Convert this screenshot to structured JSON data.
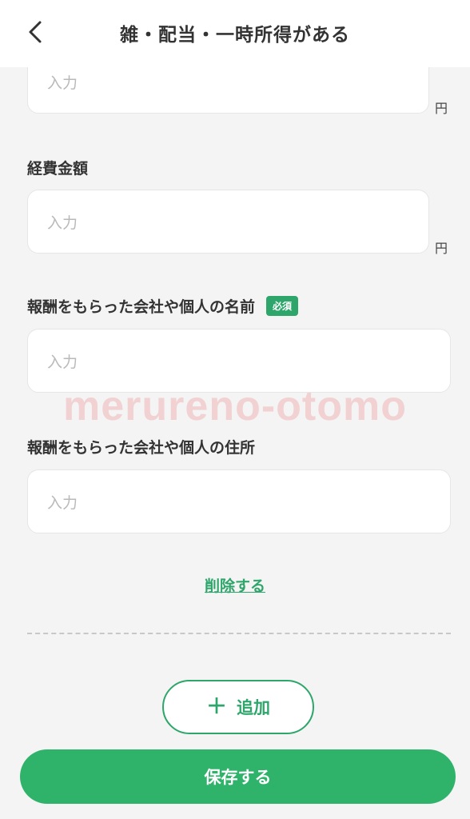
{
  "header": {
    "title": "雑・配当・一時所得がある"
  },
  "fields": [
    {
      "label": "",
      "placeholder": "入力",
      "unit": "円"
    },
    {
      "label": "経費金額",
      "placeholder": "入力",
      "unit": "円"
    },
    {
      "label": "報酬をもらった会社や個人の名前",
      "badge": "必須",
      "placeholder": "入力"
    },
    {
      "label": "報酬をもらった会社や個人の住所",
      "placeholder": "入力"
    }
  ],
  "delete_label": "削除する",
  "add_button": {
    "label": "追加",
    "icon": "plus-icon"
  },
  "save_button": {
    "label": "保存する"
  },
  "watermark": "merureno-otomo",
  "colors": {
    "accent": "#2ea66b",
    "save_button": "#2fb36b",
    "background": "#f4f4f4",
    "placeholder": "#b9b9b9"
  }
}
